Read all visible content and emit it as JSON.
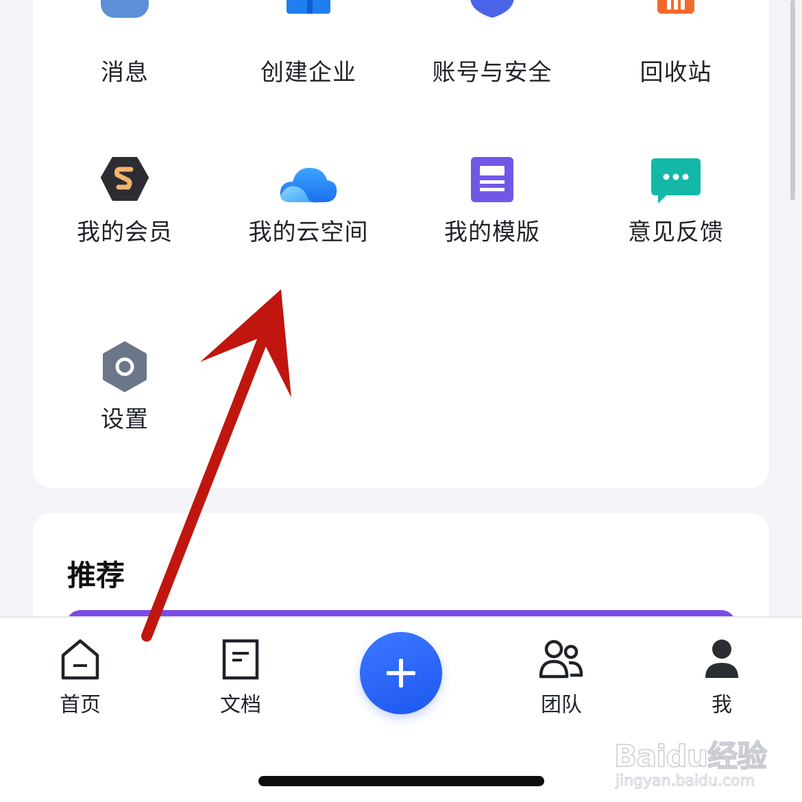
{
  "grid": {
    "row1": [
      {
        "label": "消息",
        "icon": "message-icon"
      },
      {
        "label": "创建企业",
        "icon": "create-enterprise-icon"
      },
      {
        "label": "账号与安全",
        "icon": "shield-icon"
      },
      {
        "label": "回收站",
        "icon": "recycle-bin-icon"
      }
    ],
    "row2": [
      {
        "label": "我的会员",
        "icon": "membership-icon"
      },
      {
        "label": "我的云空间",
        "icon": "cloud-icon"
      },
      {
        "label": "我的模版",
        "icon": "template-icon"
      },
      {
        "label": "意见反馈",
        "icon": "feedback-icon"
      }
    ],
    "row3": [
      {
        "label": "设置",
        "icon": "settings-icon"
      }
    ]
  },
  "recommend": {
    "title": "推荐"
  },
  "tabbar": {
    "home": "首页",
    "docs": "文档",
    "team": "团队",
    "me": "我"
  },
  "colors": {
    "accent_blue": "#2a66f5",
    "annotation_red": "#c0160f",
    "banner_purple": "#7b4be8"
  },
  "watermark": {
    "brand": "Baidu经验",
    "url": "jingyan.baidu.com"
  }
}
